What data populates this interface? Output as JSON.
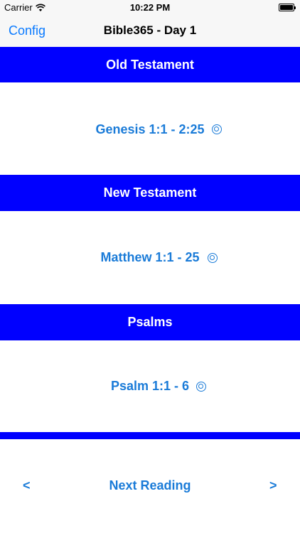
{
  "status_bar": {
    "carrier": "Carrier",
    "time": "10:22 PM"
  },
  "nav": {
    "left_label": "Config",
    "title": "Bible365 - Day 1"
  },
  "sections": [
    {
      "title": "Old Testament",
      "reading": "Genesis 1:1 - 2:25",
      "icon": "audio-icon"
    },
    {
      "title": "New Testament",
      "reading": "Matthew 1:1 - 25",
      "icon": "audio-icon"
    },
    {
      "title": "Psalms",
      "reading": "Psalm 1:1 - 6",
      "icon": "audio-icon"
    }
  ],
  "bottom": {
    "prev_label": "<",
    "next_reading_label": "Next Reading",
    "next_label": ">"
  },
  "colors": {
    "accent": "#1a7bd8",
    "header_bg": "#0000ff",
    "nav_bg": "#f7f7f7"
  }
}
